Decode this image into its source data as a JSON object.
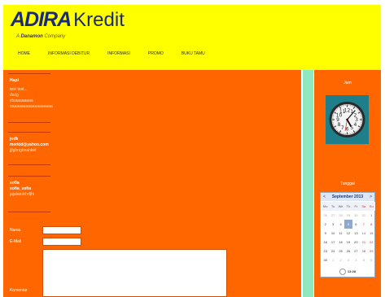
{
  "header": {
    "logo_brand": "ADIRA",
    "logo_product": "Kredit",
    "tagline_prefix": "A",
    "tagline_brand": "Danamon",
    "tagline_suffix": "Company",
    "nav": [
      "HOME",
      "INFORMASI DEBITUR",
      "INFORMASI",
      "PROMO",
      "BUKU TAMU"
    ]
  },
  "guestbook": {
    "entries": [
      {
        "name": "Hapi",
        "lines": [
          "test test...",
          "dsdg",
          "sfsaaaaaaaa",
          "aaaaaaaaaaaaaaaaaaa"
        ]
      },
      {
        "name": "jodk",
        "lines": [
          "merkid@yahoo.com",
          "jjfghnghnahkef"
        ]
      },
      {
        "name": "sofia",
        "lines": [
          "sofia_sofia",
          "jajalaertrhrfjhl"
        ]
      }
    ]
  },
  "form": {
    "name_label": "Nama",
    "email_label": "E-Mail",
    "comment_label": "Komentar"
  },
  "sidebar": {
    "clock_title": "Jam",
    "calendar_title": "Tanggal",
    "calendar": {
      "month": "September 2013",
      "prev": "<",
      "next": ">",
      "days": [
        "Mo",
        "Tu",
        "We",
        "Th",
        "Fr",
        "Sa",
        "Su"
      ],
      "weeks": [
        [
          "26",
          "27",
          "28",
          "29",
          "30",
          "31",
          "1"
        ],
        [
          "2",
          "3",
          "4",
          "5",
          "6",
          "7",
          "8"
        ],
        [
          "9",
          "10",
          "11",
          "12",
          "13",
          "14",
          "15"
        ],
        [
          "16",
          "17",
          "18",
          "19",
          "20",
          "21",
          "22"
        ],
        [
          "23",
          "24",
          "25",
          "26",
          "27",
          "28",
          "29"
        ],
        [
          "30",
          "1",
          "2",
          "3",
          "4",
          "5",
          "6"
        ]
      ],
      "today": "5",
      "time": "13:28"
    }
  }
}
